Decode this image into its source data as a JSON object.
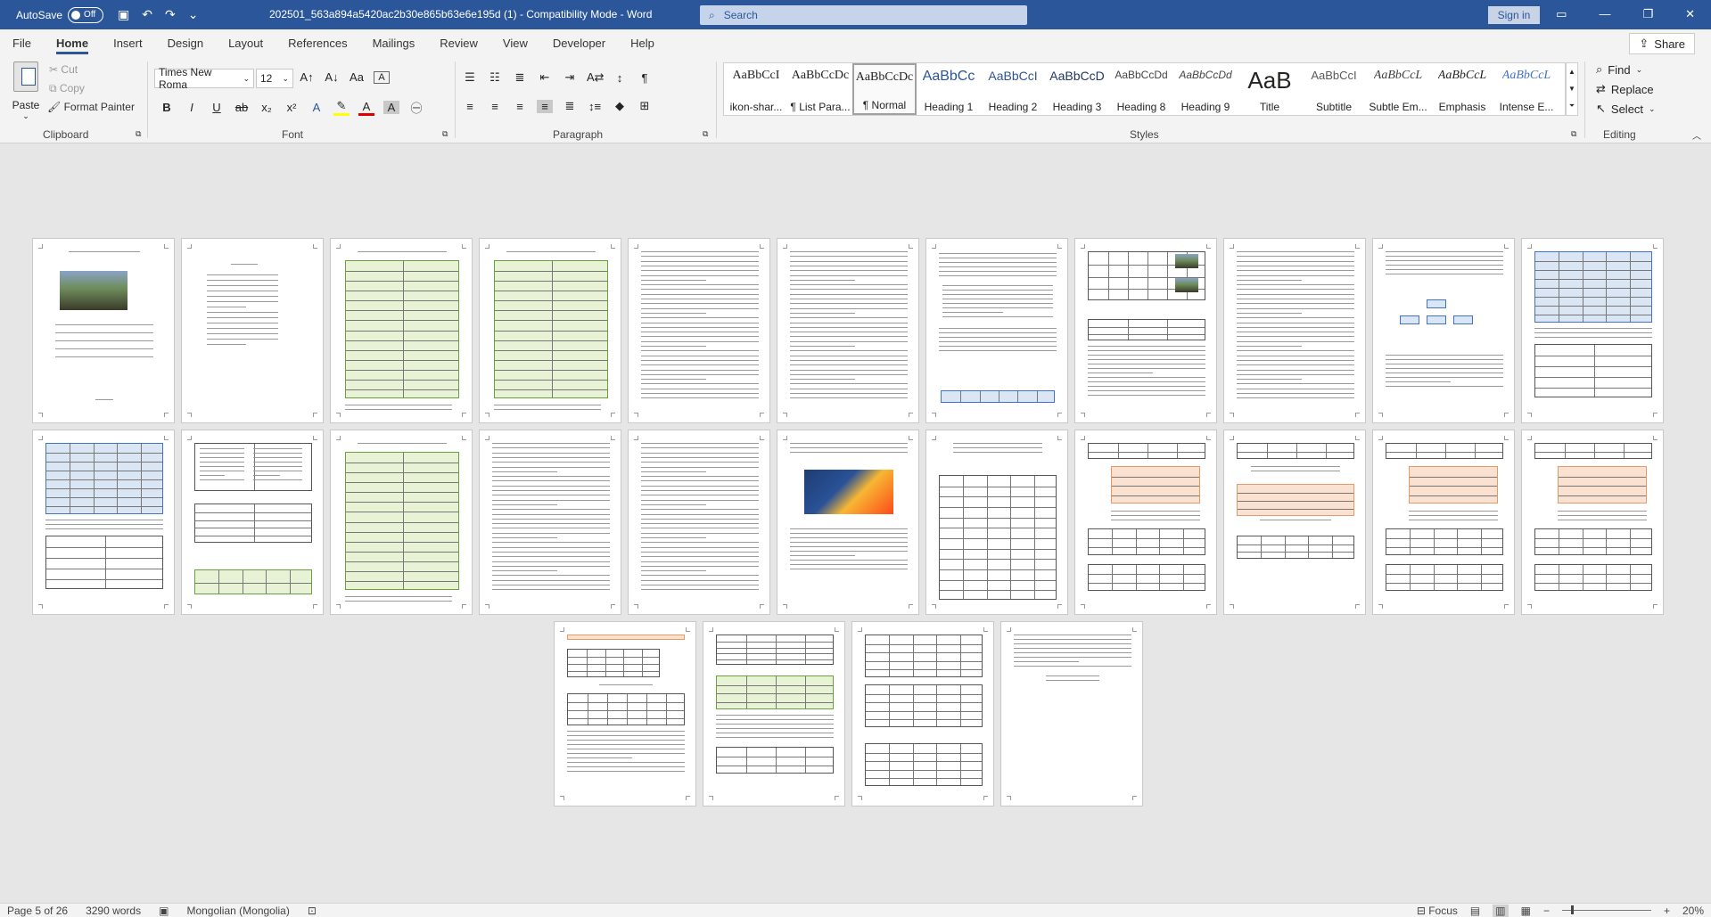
{
  "titlebar": {
    "autosave_label": "AutoSave",
    "autosave_state": "Off",
    "document_title": "202501_563a894a5420ac2b30e865b63e6e195d (1)  -  Compatibility Mode  -  Word",
    "search_placeholder": "Search",
    "signin_label": "Sign in"
  },
  "tabs": [
    "File",
    "Home",
    "Insert",
    "Design",
    "Layout",
    "References",
    "Mailings",
    "Review",
    "View",
    "Developer",
    "Help"
  ],
  "share_label": "Share",
  "ribbon": {
    "clipboard": {
      "paste": "Paste",
      "cut": "Cut",
      "copy": "Copy",
      "format_painter": "Format Painter",
      "group_label": "Clipboard"
    },
    "font": {
      "font_name": "Times New Roma",
      "font_size": "12",
      "group_label": "Font"
    },
    "paragraph": {
      "group_label": "Paragraph"
    },
    "styles": {
      "group_label": "Styles",
      "items": [
        {
          "sample": "AaBbCcI",
          "name": "ikon-shar..."
        },
        {
          "sample": "AaBbCcDc",
          "name": "¶ List Para..."
        },
        {
          "sample": "AaBbCcDc",
          "name": "¶ Normal"
        },
        {
          "sample": "AaBbCc",
          "name": "Heading 1"
        },
        {
          "sample": "AaBbCcI",
          "name": "Heading 2"
        },
        {
          "sample": "AaBbCcD",
          "name": "Heading 3"
        },
        {
          "sample": "AaBbCcDd",
          "name": "Heading 8"
        },
        {
          "sample": "AaBbCcDd",
          "name": "Heading 9"
        },
        {
          "sample": "AaB",
          "name": "Title"
        },
        {
          "sample": "AaBbCcI",
          "name": "Subtitle"
        },
        {
          "sample": "AaBbCcL",
          "name": "Subtle Em..."
        },
        {
          "sample": "AaBbCcL",
          "name": "Emphasis"
        },
        {
          "sample": "AaBbCcL",
          "name": "Intense E..."
        }
      ]
    },
    "editing": {
      "find": "Find",
      "replace": "Replace",
      "select": "Select",
      "group_label": "Editing"
    }
  },
  "status": {
    "page": "Page 5 of 26",
    "words": "3290 words",
    "language": "Mongolian (Mongolia)",
    "focus": "Focus",
    "zoom": "20%"
  }
}
